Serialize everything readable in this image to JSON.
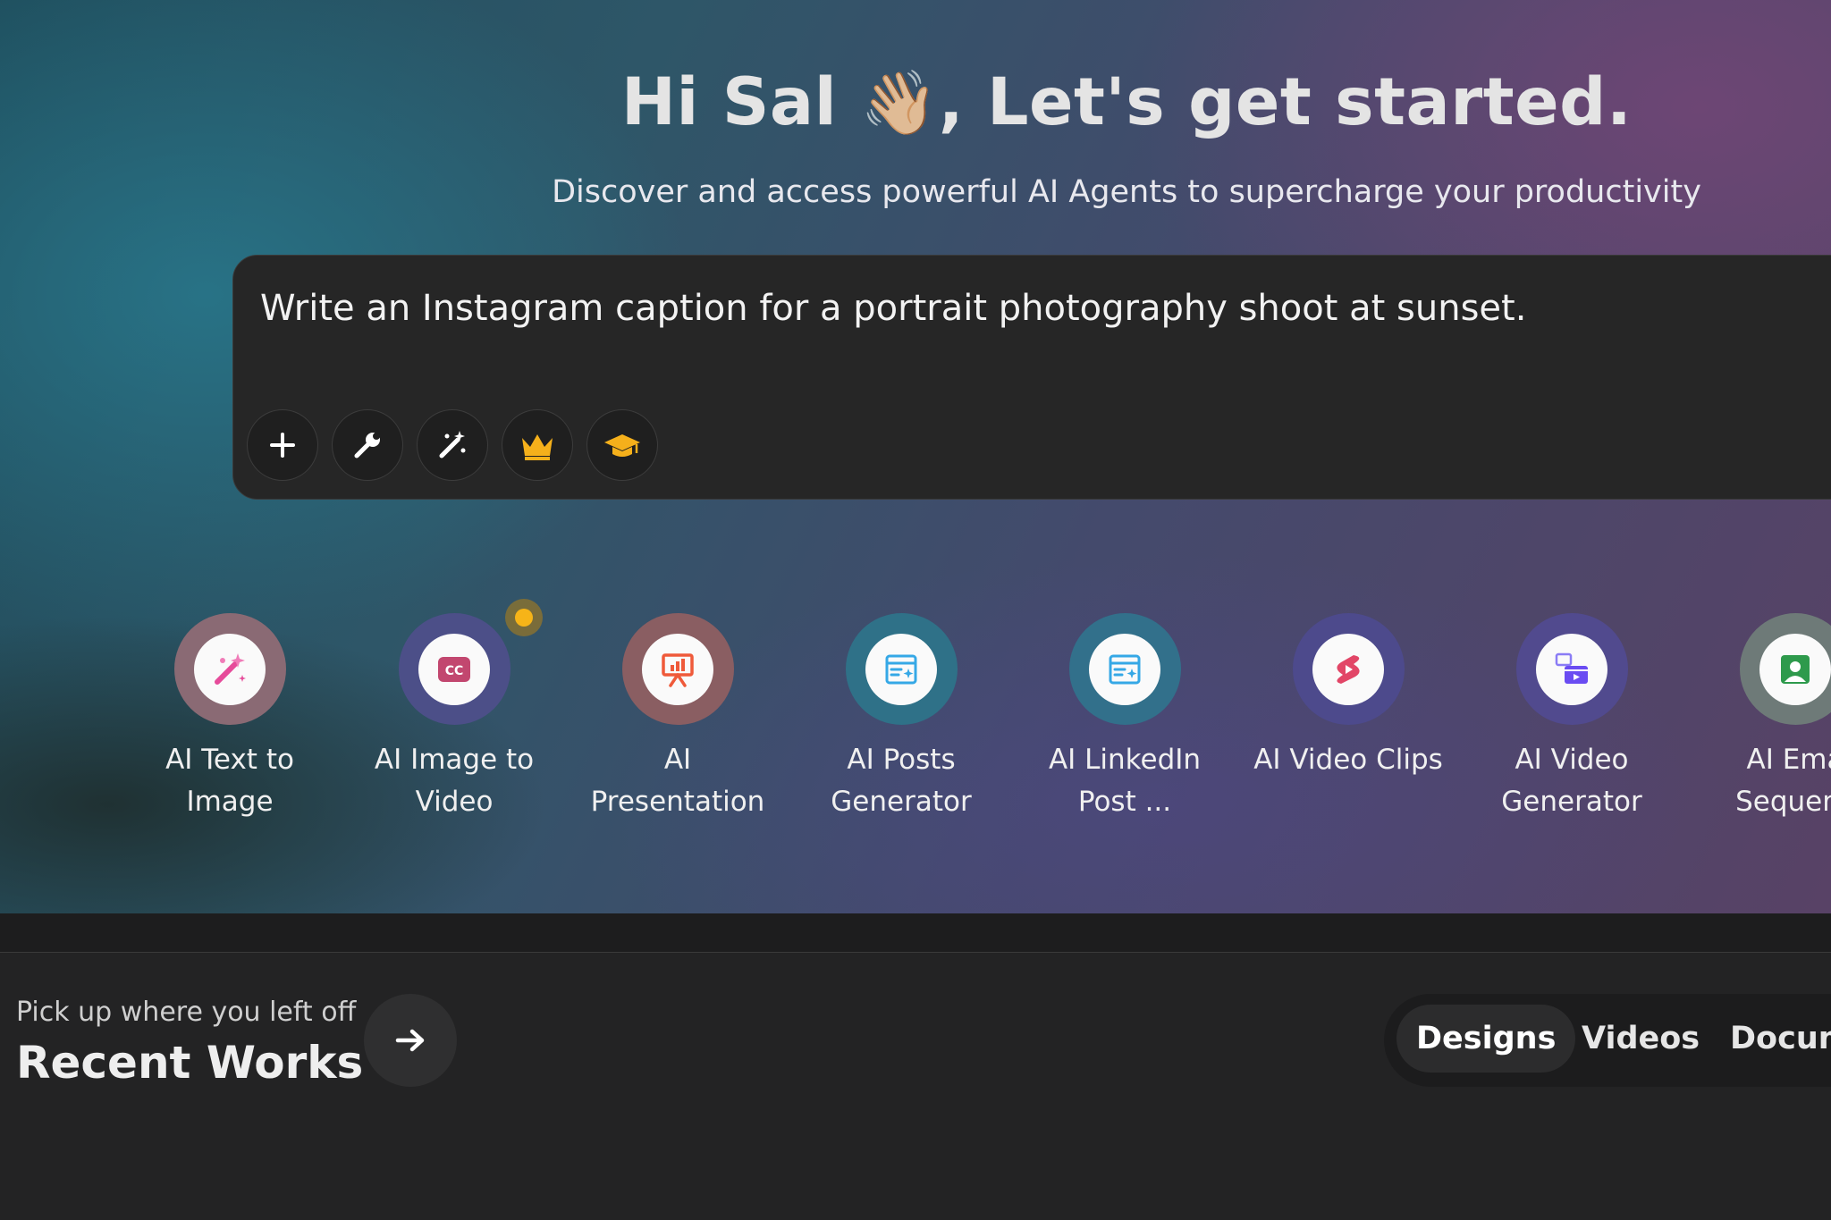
{
  "hero": {
    "greeting": "Hi Sal",
    "wave_emoji": "👋🏼",
    "greeting_rest": ", Let's get started.",
    "subtitle": "Discover and access powerful AI Agents to supercharge your productivity"
  },
  "prompt": {
    "text": "Write an Instagram caption for a portrait photography shoot at sunset.",
    "tools": [
      {
        "name": "add-icon",
        "color": "#ffffff"
      },
      {
        "name": "wrench-icon",
        "color": "#ffffff"
      },
      {
        "name": "magic-wand-icon",
        "color": "#ffffff"
      },
      {
        "name": "crown-icon",
        "color": "#f5b01b"
      },
      {
        "name": "graduation-cap-icon",
        "color": "#f5b01b"
      }
    ]
  },
  "agents": [
    {
      "label_line1": "AI Text to",
      "label_line2": "Image",
      "icon": "magic-wand-icon",
      "ring": "#8a6a74",
      "accent": "#e64b9a"
    },
    {
      "label_line1": "AI Image to",
      "label_line2": "Video",
      "icon": "closed-caption-icon",
      "ring": "#4c4f88",
      "accent": "#c2476f"
    },
    {
      "label_line1": "AI",
      "label_line2": "Presentation",
      "icon": "presentation-icon",
      "ring": "#8a5e62",
      "accent": "#ef5a3a"
    },
    {
      "label_line1": "AI Posts",
      "label_line2": "Generator",
      "icon": "post-generator-icon",
      "ring": "#2f7188",
      "accent": "#35a8e6"
    },
    {
      "label_line1": "AI LinkedIn",
      "label_line2": "Post ...",
      "icon": "post-generator-icon",
      "ring": "#32708b",
      "accent": "#35a8e6"
    },
    {
      "label_line1": "AI Video Clips",
      "label_line2": "",
      "icon": "video-clips-icon",
      "ring": "#4d4a8c",
      "accent": "#e24667"
    },
    {
      "label_line1": "AI Video",
      "label_line2": "Generator",
      "icon": "video-generator-icon",
      "ring": "#514a8e",
      "accent": "#6a4cf2"
    },
    {
      "label_line1": "AI Ema",
      "label_line2": "Sequenc",
      "icon": "email-sequence-icon",
      "ring": "#6e7a78",
      "accent": "#2e9a4c"
    }
  ],
  "recent": {
    "small_label": "Pick up where you left off",
    "title": "Recent Works"
  },
  "tabs": {
    "designs": "Designs",
    "videos": "Videos",
    "documents": "Docum"
  },
  "colors": {
    "background": "#232324",
    "prompt_bg": "#262626",
    "notification_dot": "#f6b418"
  }
}
